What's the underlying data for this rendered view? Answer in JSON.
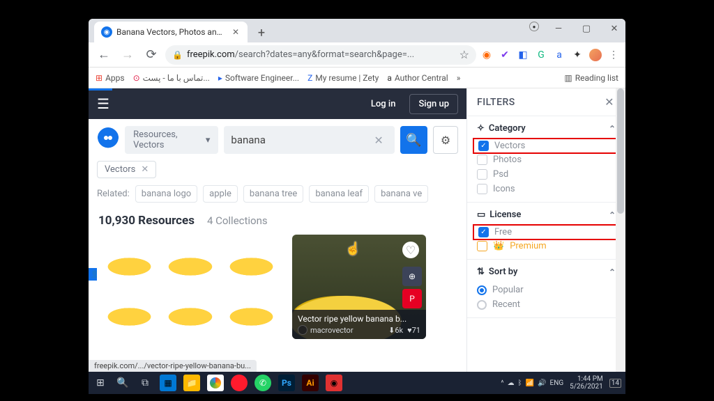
{
  "browser": {
    "tab_title": "Banana Vectors, Photos and PSD",
    "url_domain": "freepik.com",
    "url_path": "/search?dates=any&format=search&page=...",
    "bookmarks": {
      "apps": "Apps",
      "b1": "تماس با ما - پست...",
      "b2": "Software Engineer...",
      "b3": "My resume | Zety",
      "b4": "Author Central",
      "more": "»",
      "reading": "Reading list"
    }
  },
  "header": {
    "login": "Log in",
    "signup": "Sign up"
  },
  "search": {
    "selector": "Resources, Vectors",
    "query": "banana"
  },
  "active_filters": {
    "vectors": "Vectors"
  },
  "related": {
    "label": "Related:",
    "tags": [
      "banana logo",
      "apple",
      "banana tree",
      "banana leaf",
      "banana ve"
    ]
  },
  "counts": {
    "resources": "10,930 Resources",
    "collections": "4 Collections"
  },
  "cards": {
    "c2_title": "Vector ripe yellow banana b...",
    "c2_author": "macrovector",
    "c2_downloads": "6k",
    "c2_likes": "71"
  },
  "status_url": "freepik.com/.../vector-ripe-yellow-banana-bu...",
  "filters": {
    "title": "FILTERS",
    "category": {
      "title": "Category",
      "vectors": "Vectors",
      "photos": "Photos",
      "psd": "Psd",
      "icons": "Icons"
    },
    "license": {
      "title": "License",
      "free": "Free",
      "premium": "Premium"
    },
    "sort": {
      "title": "Sort by",
      "popular": "Popular",
      "recent": "Recent"
    }
  },
  "taskbar": {
    "lang": "ENG",
    "time": "1:44 PM",
    "date": "5/26/2021",
    "notif": "14"
  }
}
